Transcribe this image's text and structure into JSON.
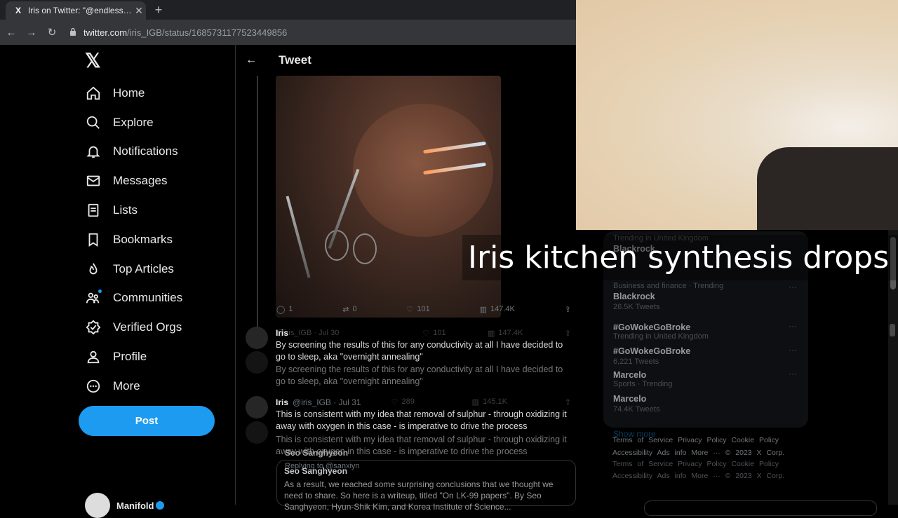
{
  "browser": {
    "tab_title": "Iris on Twitter: \"@endless_sine @",
    "tab_favicon": "X",
    "url_host": "twitter.com",
    "url_path": "/iris_IGB/status/1685731177523449856",
    "back_icon": "←",
    "forward_icon": "→",
    "reload_icon": "↻",
    "new_tab_icon": "+",
    "close_icon": "✕",
    "lock_icon": "🔒"
  },
  "sidebar": {
    "logo": "𝕏",
    "items": [
      {
        "label": "Home",
        "icon": "home-icon"
      },
      {
        "label": "Explore",
        "icon": "search-icon"
      },
      {
        "label": "Notifications",
        "icon": "bell-icon"
      },
      {
        "label": "Messages",
        "icon": "mail-icon"
      },
      {
        "label": "Lists",
        "icon": "list-icon"
      },
      {
        "label": "Bookmarks",
        "icon": "bookmark-icon"
      },
      {
        "label": "Top Articles",
        "icon": "flame-icon"
      },
      {
        "label": "Communities",
        "icon": "people-icon"
      },
      {
        "label": "Verified Orgs",
        "icon": "verified-icon"
      },
      {
        "label": "Profile",
        "icon": "person-icon"
      },
      {
        "label": "More",
        "icon": "more-circle-icon"
      }
    ],
    "post_label": "Post",
    "account_name": "Manifold"
  },
  "center": {
    "header_title": "Tweet",
    "back_icon": "←",
    "main_actions": {
      "replies": "1",
      "retweets": "0",
      "likes": "101",
      "views": "147.4K"
    },
    "ghost_actions": {
      "replies": "",
      "retweets": "",
      "likes": "101",
      "views": "147.4K"
    },
    "ghost_header": "@iris_IGB · Jul 30",
    "replies": [
      {
        "name": "Iris",
        "handle": "",
        "text": "By screening the results of this for any conductivity at all I have decided to go to sleep, aka \"overnight annealing\""
      },
      {
        "name": "",
        "handle": "",
        "text": "By screening the results of this for any conductivity at all I have decided to go to sleep, aka \"overnight annealing\""
      },
      {
        "name": "Iris",
        "handle": "@iris_IGB · Jul 31",
        "text": "This is consistent with my idea that removal of sulphur - through oxidizing it away with oxygen in this case - is imperative to drive the process"
      },
      {
        "name": "",
        "handle": "",
        "text": "This is consistent with my idea that removal of sulphur - through oxidizing it away with oxygen in this case - is imperative to drive the process"
      }
    ],
    "mid_actions": {
      "likes": "289",
      "views": "145.1K"
    },
    "seo_line": "Seo Sanghyeon",
    "replying_to": "Replying to @sanxiyn",
    "quote_name": "Seo Sanghyeon",
    "quote_text": "As a result, we reached some surprising conclusions that we thought we need to share. So here is a writeup, titled \"On LK-99 papers\". By Seo Sanghyeon, Hyun-Shik Kim, and Korea Institute of Science..."
  },
  "caption": "Iris kitchen synthesis drops",
  "trends": [
    {
      "meta": "Trending in United Kingdom",
      "title": "Blackrock",
      "sub": ""
    },
    {
      "meta": "Business and finance · Trending",
      "title": "Blackrock",
      "sub": "26.5K Tweets"
    },
    {
      "meta": "Trending in United Kingdom",
      "title": "#GoWokeGoBroke",
      "sub": ""
    },
    {
      "meta": "Trending in United Kingdom",
      "title": "#GoWokeGoBroke",
      "sub": "6,221 Tweets"
    },
    {
      "meta": "Sports · Trending",
      "title": "Marcelo",
      "sub": ""
    },
    {
      "meta": "Sports · Trending",
      "title": "Marcelo",
      "sub": "74.4K Tweets"
    }
  ],
  "show_more": "Show more",
  "footer_1": "Terms of Service   Privacy Policy   Cookie Policy",
  "footer_2": "Accessibility   Ads info   More ···   © 2023 X Corp."
}
